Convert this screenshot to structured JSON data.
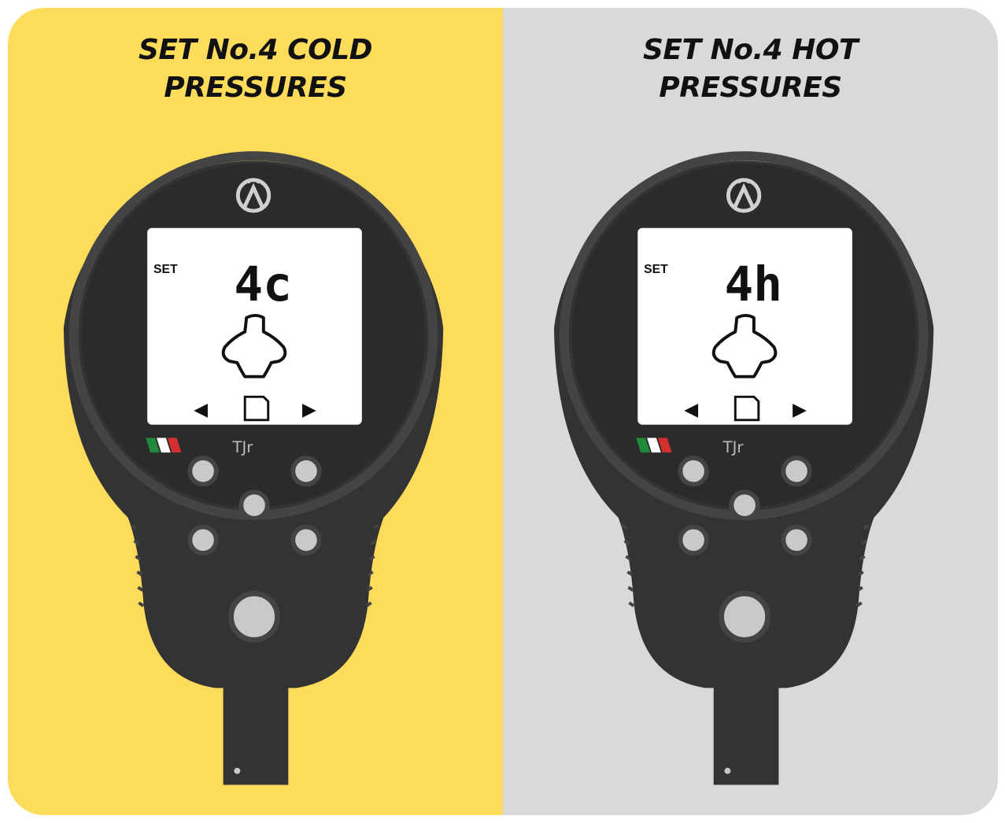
{
  "colors": {
    "cold_bg": "#fddc5c",
    "hot_bg": "#d9d9d9",
    "body": "#333333",
    "screen": "#ffffff",
    "flag": [
      "#1f8a3a",
      "#ffffff",
      "#d32f2f"
    ]
  },
  "panels": [
    {
      "id": "cold",
      "title_line1": "SET No.4 COLD",
      "title_line2": "PRESSURES",
      "screen": {
        "set_label": "SET",
        "segment_value": "4c",
        "icons": [
          "arrow-left-icon",
          "sd-card-icon",
          "arrow-right-icon",
          "kart-icon"
        ]
      },
      "brand_logo": "TJr"
    },
    {
      "id": "hot",
      "title_line1": "SET No.4 HOT",
      "title_line2": "PRESSURES",
      "screen": {
        "set_label": "SET",
        "segment_value": "4h",
        "icons": [
          "arrow-left-icon",
          "sd-card-icon",
          "arrow-right-icon",
          "kart-icon"
        ]
      },
      "brand_logo": "TJr"
    }
  ]
}
